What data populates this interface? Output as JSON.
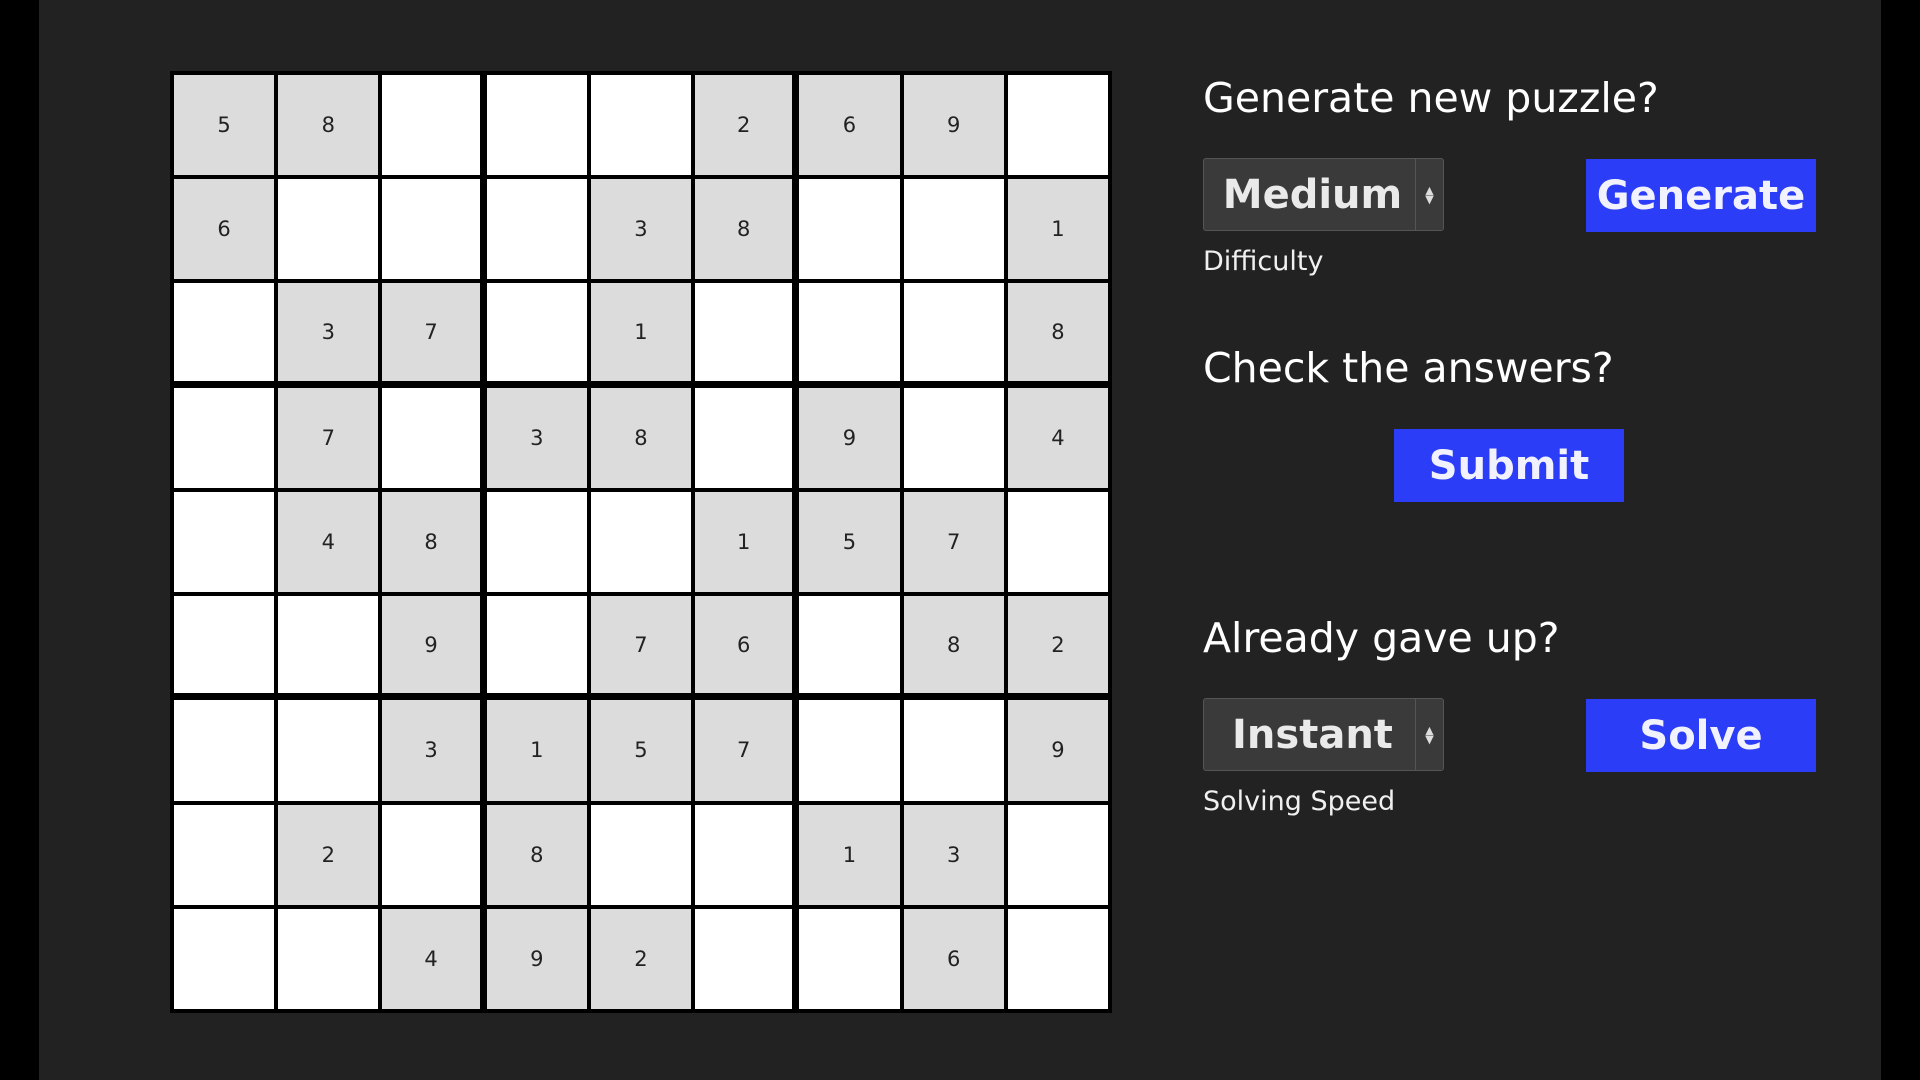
{
  "colors": {
    "background": "#222222",
    "given_cell": "#dcdcdc",
    "empty_cell": "#ffffff",
    "button": "#2b3df7"
  },
  "board": {
    "rows": [
      [
        "5",
        "8",
        "",
        "",
        "",
        "2",
        "6",
        "9",
        ""
      ],
      [
        "6",
        "",
        "",
        "",
        "3",
        "8",
        "",
        "",
        "1"
      ],
      [
        "",
        "3",
        "7",
        "",
        "1",
        "",
        "",
        "",
        "8"
      ],
      [
        "",
        "7",
        "",
        "3",
        "8",
        "",
        "9",
        "",
        "4"
      ],
      [
        "",
        "4",
        "8",
        "",
        "",
        "1",
        "5",
        "7",
        ""
      ],
      [
        "",
        "",
        "9",
        "",
        "7",
        "6",
        "",
        "8",
        "2"
      ],
      [
        "",
        "",
        "3",
        "1",
        "5",
        "7",
        "",
        "",
        "9"
      ],
      [
        "",
        "2",
        "",
        "8",
        "",
        "",
        "1",
        "3",
        ""
      ],
      [
        "",
        "",
        "4",
        "9",
        "2",
        "",
        "",
        "6",
        ""
      ]
    ]
  },
  "generate": {
    "heading": "Generate new puzzle?",
    "difficulty_value": "Medium",
    "difficulty_label": "Difficulty",
    "button_label": "Generate"
  },
  "check": {
    "heading": "Check the answers?",
    "button_label": "Submit"
  },
  "solve": {
    "heading": "Already gave up?",
    "speed_value": "Instant",
    "speed_label": "Solving Speed",
    "button_label": "Solve"
  },
  "icons": {
    "select_arrows": "updown-arrows-icon"
  }
}
